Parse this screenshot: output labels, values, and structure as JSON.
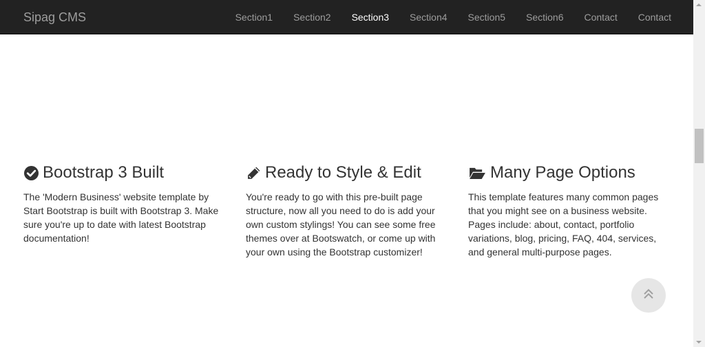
{
  "navbar": {
    "brand": "Sipag CMS",
    "items": [
      {
        "label": "Section1"
      },
      {
        "label": "Section2"
      },
      {
        "label": "Section3"
      },
      {
        "label": "Section4"
      },
      {
        "label": "Section5"
      },
      {
        "label": "Section6"
      },
      {
        "label": "Contact"
      },
      {
        "label": "Contact"
      }
    ],
    "active_item": "Section3",
    "background": "#222222",
    "text_color": "#9d9d9d",
    "active_color": "#ffffff"
  },
  "features": [
    {
      "icon": "check-circle-icon",
      "title": "Bootstrap 3 Built",
      "text": "The 'Modern Business' website template by Start Bootstrap is built with Bootstrap 3. Make sure you're up to date with latest Bootstrap documentation!"
    },
    {
      "icon": "pencil-icon",
      "title": "Ready to Style & Edit",
      "text": "You're ready to go with this pre-built page structure, now all you need to do is add your own custom stylings! You can see some free themes over at Bootswatch, or come up with your own using the Bootstrap customizer!"
    },
    {
      "icon": "folder-open-icon",
      "title": "Many Page Options",
      "text": "This template features many common pages that you might see on a business website. Pages include: about, contact, portfolio variations, blog, pricing, FAQ, 404, services, and general multi-purpose pages."
    }
  ],
  "back_to_top": {
    "icon": "double-chevron-up-icon"
  }
}
